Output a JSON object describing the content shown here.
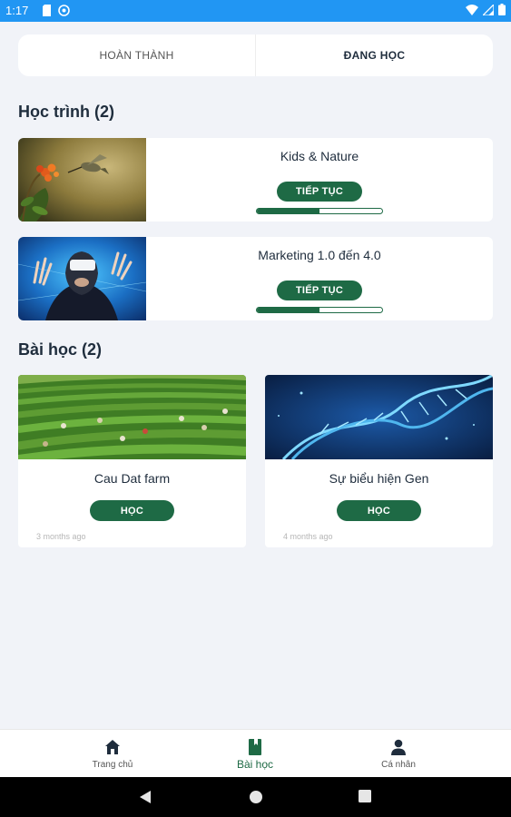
{
  "status_bar": {
    "time": "1:17",
    "left_icons": [
      "sd-card-icon",
      "sync-icon"
    ],
    "right_icons": [
      "wifi-icon",
      "signal-icon",
      "battery-icon"
    ]
  },
  "tabs": [
    {
      "label": "HOÀN THÀNH",
      "active": false
    },
    {
      "label": "ĐANG HỌC",
      "active": true
    }
  ],
  "courses": {
    "heading": "Học trình (2)",
    "items": [
      {
        "title": "Kids & Nature",
        "button": "TIẾP TỤC",
        "progress": 0.5
      },
      {
        "title": "Marketing 1.0 đến 4.0",
        "button": "TIẾP TỤC",
        "progress": 0.5
      }
    ]
  },
  "lessons": {
    "heading": "Bài học (2)",
    "items": [
      {
        "title": "Cau Dat farm",
        "button": "HỌC",
        "time": "3 months ago"
      },
      {
        "title": "Sự biểu hiện Gen",
        "button": "HỌC",
        "time": "4 months ago"
      }
    ]
  },
  "bottom_nav": [
    {
      "label": "Trang chủ",
      "icon": "home-icon",
      "active": false
    },
    {
      "label": "Bài học",
      "icon": "book-icon",
      "active": true
    },
    {
      "label": "Cá nhân",
      "icon": "person-icon",
      "active": false
    }
  ],
  "system_nav": [
    "back-icon",
    "home-circle-icon",
    "recents-icon"
  ],
  "colors": {
    "accent": "#1e6a45",
    "status_bar": "#2196f3",
    "background": "#f1f3f8"
  }
}
